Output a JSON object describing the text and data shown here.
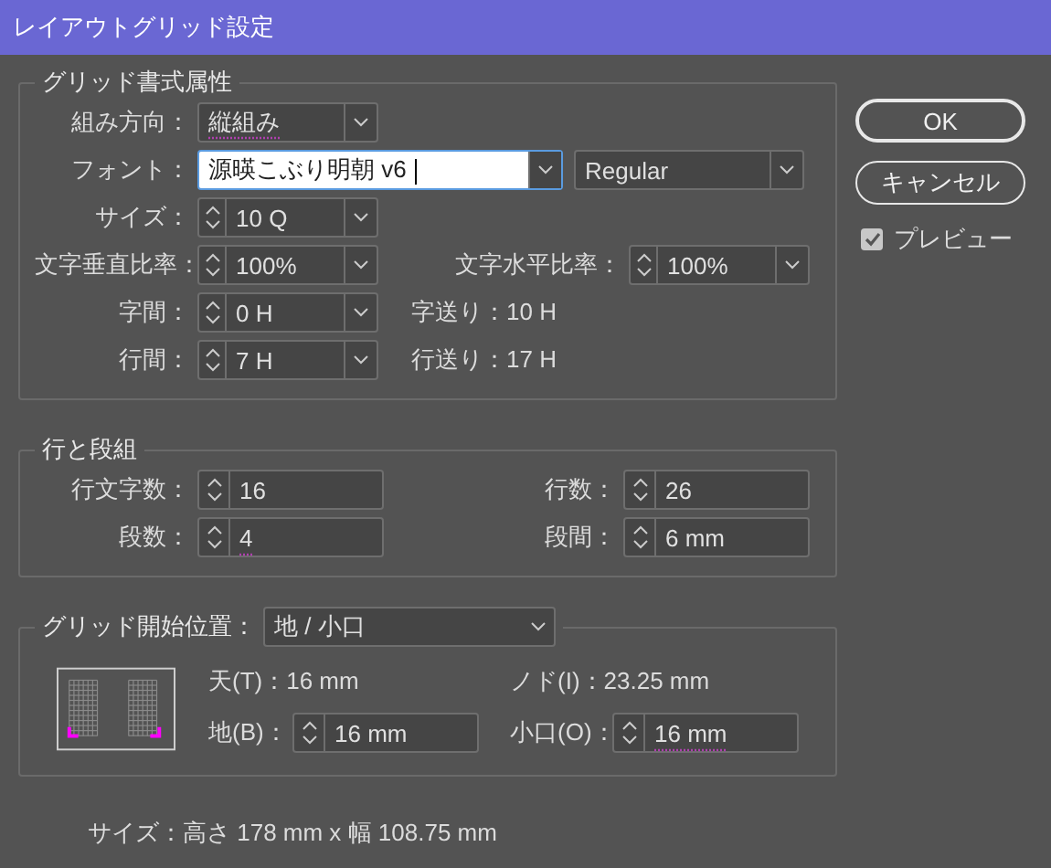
{
  "window": {
    "title": "レイアウトグリッド設定"
  },
  "grid_format": {
    "legend": "グリッド書式属性",
    "rows": [
      {
        "items": [
          {
            "kind": "dropdown",
            "label": "組み方向：",
            "value": "縦組み",
            "underlined": true
          }
        ]
      },
      {
        "items": [
          {
            "kind": "font",
            "label": "フォント：",
            "value": "源暎こぶり明朝 v6",
            "focused": true
          },
          {
            "kind": "dropdown",
            "value": "Regular",
            "underlined": false
          }
        ]
      },
      {
        "items": [
          {
            "kind": "spin_combo",
            "label": "サイズ：",
            "value": "10 Q"
          }
        ]
      },
      {
        "items": [
          {
            "kind": "spin_combo",
            "label": "文字垂直比率：",
            "value": "100%"
          },
          {
            "kind": "spin_combo",
            "label": "文字水平比率：",
            "value": "100%"
          }
        ]
      },
      {
        "items": [
          {
            "kind": "spin_combo",
            "label": "字間：",
            "value": "0 H"
          },
          {
            "kind": "info",
            "text": "字送り：10 H"
          }
        ]
      },
      {
        "items": [
          {
            "kind": "spin_combo",
            "label": "行間：",
            "value": "7 H"
          },
          {
            "kind": "info",
            "text": "行送り：17 H"
          }
        ]
      }
    ]
  },
  "lines_and_columns": {
    "legend": "行と段組",
    "fields": [
      {
        "label": "行文字数：",
        "value": "16",
        "underlined": false
      },
      {
        "label": "行数：",
        "value": "26",
        "underlined": false
      },
      {
        "label": "段数：",
        "value": "4",
        "underlined": true
      },
      {
        "label": "段間：",
        "value": "6 mm",
        "underlined": false
      }
    ]
  },
  "grid_start": {
    "label": "グリッド開始位置：",
    "value": "地 / 小口",
    "items": [
      {
        "kind": "info",
        "text": "天(T)：16 mm"
      },
      {
        "kind": "info",
        "text": "ノド(I)：23.25 mm"
      },
      {
        "kind": "spin",
        "label": "地(B)：",
        "value": "16 mm",
        "underlined": false
      },
      {
        "kind": "spin",
        "label": "小口(O)：",
        "value": "16 mm",
        "underlined": true
      }
    ]
  },
  "size_summary": "サイズ：高さ 178 mm x 幅  108.75 mm",
  "buttons": [
    {
      "label": "OK",
      "default": true
    },
    {
      "label": "キャンセル",
      "default": false
    }
  ],
  "preview": {
    "label": "プレビュー",
    "checked": true
  }
}
